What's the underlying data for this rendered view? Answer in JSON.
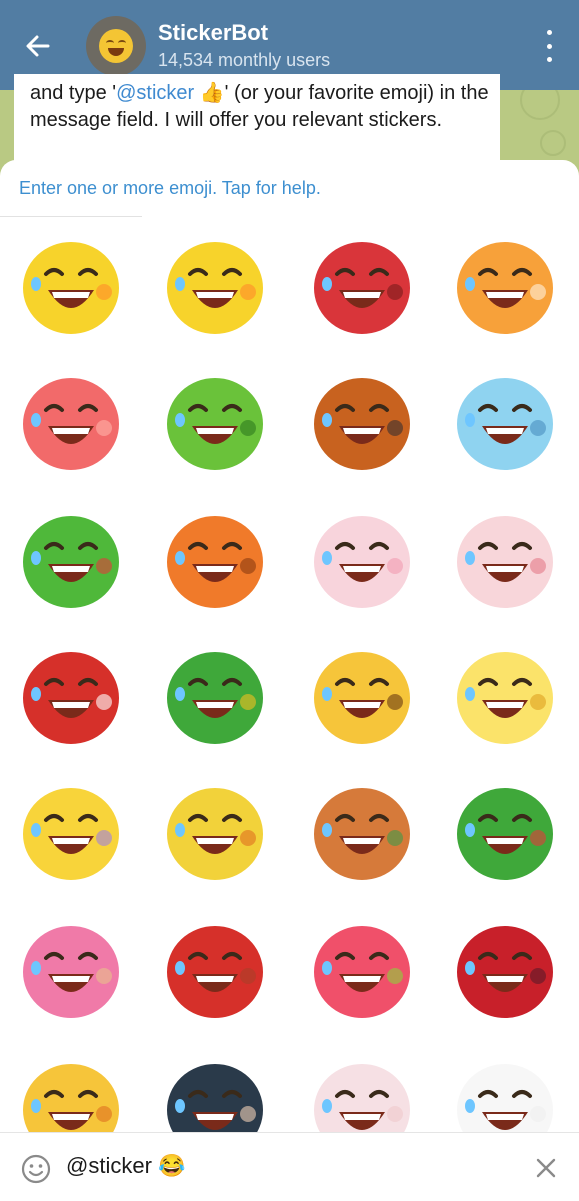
{
  "header": {
    "title": "StickerBot",
    "subtitle": "14,534 monthly users",
    "color": "#527da3"
  },
  "message": {
    "line_prefix": "and type '",
    "mention": "@sticker",
    "line_suffix": " 👍' (or your favorite emoji) in the message field. I will offer you relevant stickers."
  },
  "panel": {
    "hint": "Enter one or more emoji. Tap for help."
  },
  "stickers": [
    {
      "name": "sticker-yellow-duck-laughing",
      "body": "#f7d32b",
      "accent": "#ff8c2a"
    },
    {
      "name": "sticker-duck-giggle",
      "body": "#f7d32b",
      "accent": "#ff8c2a"
    },
    {
      "name": "sticker-red-bear-laughing",
      "body": "#d9353a",
      "accent": "#7a1a1a"
    },
    {
      "name": "sticker-orange-cat-laughing",
      "body": "#f7a13a",
      "accent": "#fff1dc"
    },
    {
      "name": "sticker-peach-laughing",
      "body": "#f26a6a",
      "accent": "#ffb3a8"
    },
    {
      "name": "sticker-green-crocodile-laughing",
      "body": "#6ac23a",
      "accent": "#2f7a1e"
    },
    {
      "name": "sticker-orangutan-laughing",
      "body": "#c8621f",
      "accent": "#3a3030"
    },
    {
      "name": "sticker-blue-cat-laughing",
      "body": "#8fd3f0",
      "accent": "#4a90c0"
    },
    {
      "name": "sticker-dinosaur-ha-ha",
      "body": "#4fb83a",
      "accent": "#e23a3a"
    },
    {
      "name": "sticker-fox-facepalm-laugh",
      "body": "#f07a2a",
      "accent": "#8a3a10"
    },
    {
      "name": "sticker-pink-bunny-laughing",
      "body": "#f8d4dc",
      "accent": "#f29bb0"
    },
    {
      "name": "sticker-pink-cat-pointing",
      "body": "#f8d6da",
      "accent": "#e47a88"
    },
    {
      "name": "sticker-santa-ho",
      "body": "#d6302a",
      "accent": "#ffffff"
    },
    {
      "name": "sticker-lizard-laughing",
      "body": "#3fa83a",
      "accent": "#f0c020"
    },
    {
      "name": "sticker-grinning-face",
      "body": "#f6c53a",
      "accent": "#6a3a10"
    },
    {
      "name": "sticker-waving-hand-laughing",
      "body": "#fbe36a",
      "accent": "#e0a020"
    },
    {
      "name": "sticker-heart-balloon-laughing",
      "body": "#f8d43a",
      "accent": "#a080e0"
    },
    {
      "name": "sticker-dog-emoji-laughing",
      "body": "#f2d23a",
      "accent": "#e07020"
    },
    {
      "name": "sticker-corgi-laughing",
      "body": "#d67a3a",
      "accent": "#3f9a4a"
    },
    {
      "name": "sticker-christmas-tree-laughing",
      "body": "#3fa83a",
      "accent": "#e23a3a"
    },
    {
      "name": "sticker-pink-haired-girl-laughing",
      "body": "#f07aa8",
      "accent": "#e8c08a"
    },
    {
      "name": "sticker-santa-chimney-ha",
      "body": "#d6302a",
      "accent": "#a8402a"
    },
    {
      "name": "sticker-mushroom-laughing",
      "body": "#f0506a",
      "accent": "#8ad23a"
    },
    {
      "name": "sticker-vampire-lady-laughing",
      "body": "#c8202a",
      "accent": "#5a1a2a"
    },
    {
      "name": "sticker-chick-laughing",
      "body": "#f6c53a",
      "accent": "#e07020"
    },
    {
      "name": "sticker-pinup-woman-laughing",
      "body": "#2a3a4a",
      "accent": "#f2d0b8"
    },
    {
      "name": "sticker-loading-faded",
      "body": "#f6e0e4",
      "accent": "#f0c8cc"
    },
    {
      "name": "sticker-loading-blank",
      "body": "#f7f7f7",
      "accent": "#efefef"
    }
  ],
  "input": {
    "value": "@sticker 😂"
  }
}
